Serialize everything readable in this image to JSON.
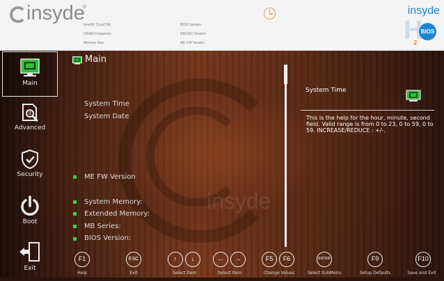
{
  "header": {
    "logo": "insyde",
    "logo_reg": "®",
    "info_labels": [
      "Intel(R) Core(TM)",
      "DRAM Frequency",
      "Memory Size"
    ],
    "info_labels_2": [
      "BIOS Version",
      "KBC/EC Version",
      "ME FW Version"
    ],
    "brand": "insyde",
    "brand_big": "H",
    "brand_badge": "BIOS",
    "brand_sub": "2"
  },
  "sidebar": {
    "items": [
      {
        "label": "Main",
        "icon": "monitor-icon",
        "active": true
      },
      {
        "label": "Advanced",
        "icon": "document-search-icon",
        "active": false
      },
      {
        "label": "Security",
        "icon": "shield-icon",
        "active": false
      },
      {
        "label": "Boot",
        "icon": "power-icon",
        "active": false
      },
      {
        "label": "Exit",
        "icon": "exit-door-icon",
        "active": false
      }
    ]
  },
  "main": {
    "title": "Main",
    "fields": {
      "system_time": "System Time",
      "system_date": "System Date",
      "me_fw_version": "ME FW Version",
      "system_memory": "System Memory:",
      "extended_memory": "Extended Memory:",
      "mb_series": "MB Series:",
      "bios_version": "BIOS Version:"
    }
  },
  "help": {
    "title": "System Time",
    "text": "This is the help for the hour, minute, second field. Valid range is from 0 to 23, 0 to 59, 0 to 59. INCREASE/REDUCE : +/-."
  },
  "footer": {
    "keys": {
      "f1": "F1",
      "esc": "ESC",
      "up": "↑",
      "down": "↓",
      "left": "←",
      "right": "→",
      "f5": "F5",
      "f6": "F6",
      "enter": "ENTER",
      "f9": "F9",
      "f10": "F10"
    },
    "labels": {
      "help": "Help",
      "exit": "Exit",
      "select_item_1": "Select Item",
      "select_item_2": "Select Item",
      "change_values": "Change Values",
      "select_submenu": "Select  SubMenu",
      "setup_defaults": "Setup Defaults",
      "save_exit": "Save and Exit"
    }
  },
  "colors": {
    "accent_green": "#3dd14a",
    "brand_blue": "#1b87d0",
    "wood_dark": "#2a120a"
  },
  "watermark": "insyde"
}
